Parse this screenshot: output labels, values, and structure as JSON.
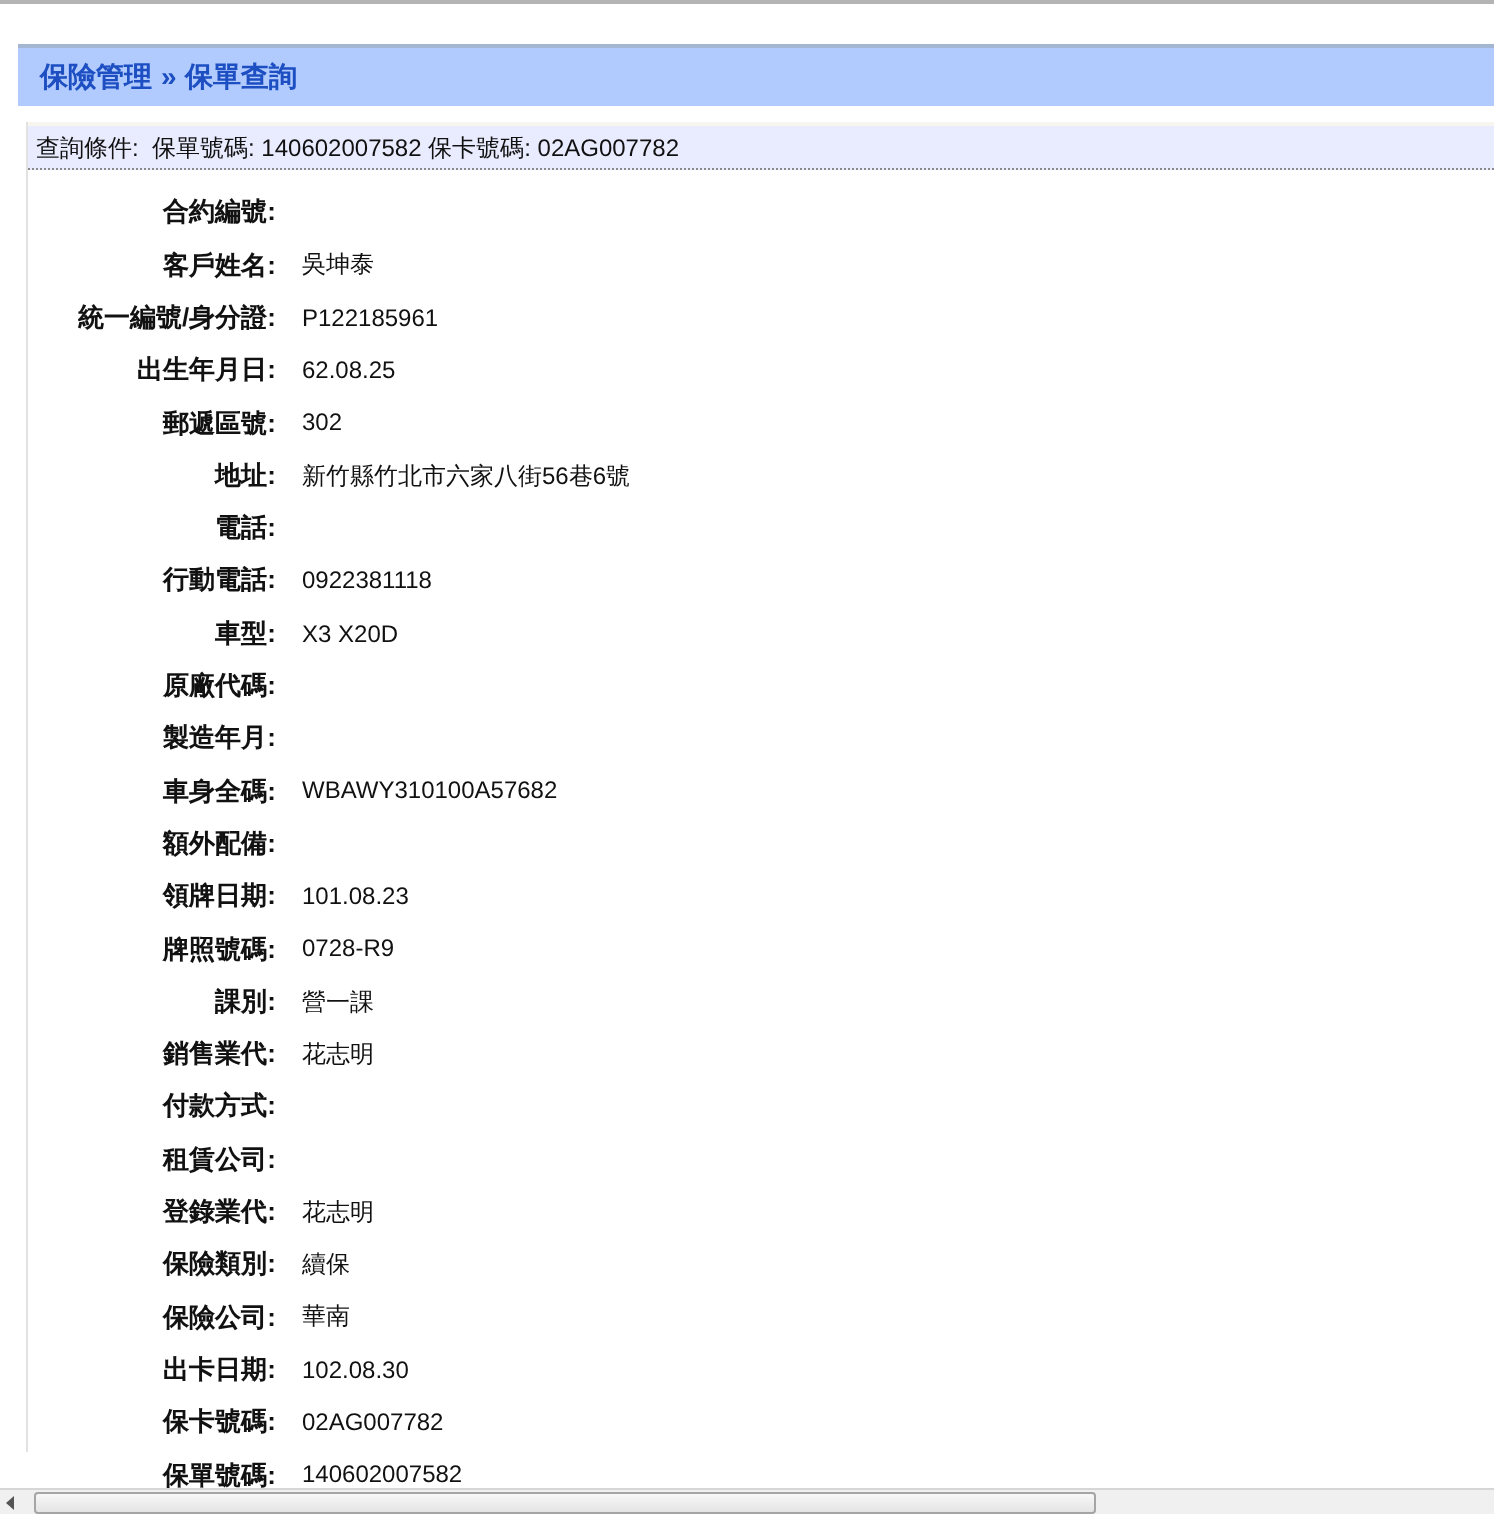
{
  "breadcrumb": {
    "section": "保險管理",
    "separator": "»",
    "page": "保單查詢"
  },
  "query": {
    "label": "查詢條件:",
    "text": "保單號碼: 140602007582 保卡號碼: 02AG007782"
  },
  "fields": [
    {
      "label": "合約編號:"
    },
    {
      "label": "客戶姓名:",
      "value": "吳坤泰"
    },
    {
      "label": "統一編號/身分證:",
      "value": "P122185961"
    },
    {
      "label": "出生年月日:",
      "value": "62.08.25"
    },
    {
      "label": "郵遞區號:",
      "value": "302"
    },
    {
      "label": "地址:",
      "value": "新竹縣竹北市六家八街56巷6號"
    },
    {
      "label": "電話:"
    },
    {
      "label": "行動電話:",
      "value": "0922381118"
    },
    {
      "label": "車型:",
      "value": "X3 X20D"
    },
    {
      "label": "原廠代碼:"
    },
    {
      "label": "製造年月:"
    },
    {
      "label": "車身全碼:",
      "value": "WBAWY310100A57682"
    },
    {
      "label": "額外配備:"
    },
    {
      "label": "領牌日期:",
      "value": "101.08.23"
    },
    {
      "label": "牌照號碼:",
      "value": "0728-R9"
    },
    {
      "label": "課別:",
      "value": "營一課"
    },
    {
      "label": "銷售業代:",
      "value": "花志明"
    },
    {
      "label": "付款方式:"
    },
    {
      "label": "租賃公司:"
    },
    {
      "label": "登錄業代:",
      "value": "花志明"
    },
    {
      "label": "保險類別:",
      "value": "續保"
    },
    {
      "label": "保險公司:",
      "value": "華南"
    },
    {
      "label": "出卡日期:",
      "value": "102.08.30"
    },
    {
      "label": "保卡號碼:",
      "value": "02AG007782"
    },
    {
      "label": "保單號碼:",
      "value": "140602007582"
    }
  ]
}
